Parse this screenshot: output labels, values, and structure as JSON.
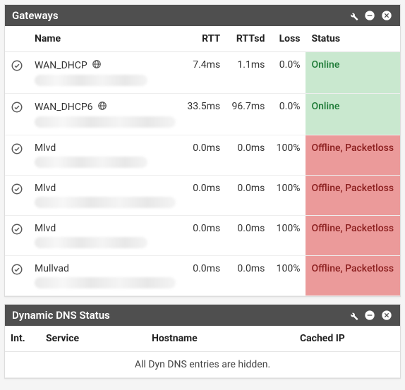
{
  "gateways_widget": {
    "title": "Gateways",
    "columns": {
      "name": "Name",
      "rtt": "RTT",
      "rttsd": "RTTsd",
      "loss": "Loss",
      "status": "Status"
    },
    "rows": [
      {
        "name": "WAN_DHCP",
        "globe": true,
        "rtt": "7.4ms",
        "rttsd": "1.1ms",
        "loss": "0.0%",
        "status": "Online",
        "status_kind": "online"
      },
      {
        "name": "WAN_DHCP6",
        "globe": true,
        "rtt": "33.5ms",
        "rttsd": "96.7ms",
        "loss": "0.0%",
        "status": "Online",
        "status_kind": "online"
      },
      {
        "name": "Mlvd",
        "globe": false,
        "rtt": "0.0ms",
        "rttsd": "0.0ms",
        "loss": "100%",
        "status": "Offline, Packetloss",
        "status_kind": "offline"
      },
      {
        "name": "Mlvd",
        "globe": false,
        "rtt": "0.0ms",
        "rttsd": "0.0ms",
        "loss": "100%",
        "status": "Offline, Packetloss",
        "status_kind": "offline"
      },
      {
        "name": "Mlvd",
        "globe": false,
        "rtt": "0.0ms",
        "rttsd": "0.0ms",
        "loss": "100%",
        "status": "Offline, Packetloss",
        "status_kind": "offline"
      },
      {
        "name": "Mullvad",
        "globe": false,
        "rtt": "0.0ms",
        "rttsd": "0.0ms",
        "loss": "100%",
        "status": "Offline, Packetloss",
        "status_kind": "offline"
      }
    ]
  },
  "ddns_widget": {
    "title": "Dynamic DNS Status",
    "columns": {
      "int": "Int.",
      "service": "Service",
      "hostname": "Hostname",
      "cached_ip": "Cached IP"
    },
    "message": "All Dyn DNS entries are hidden."
  }
}
